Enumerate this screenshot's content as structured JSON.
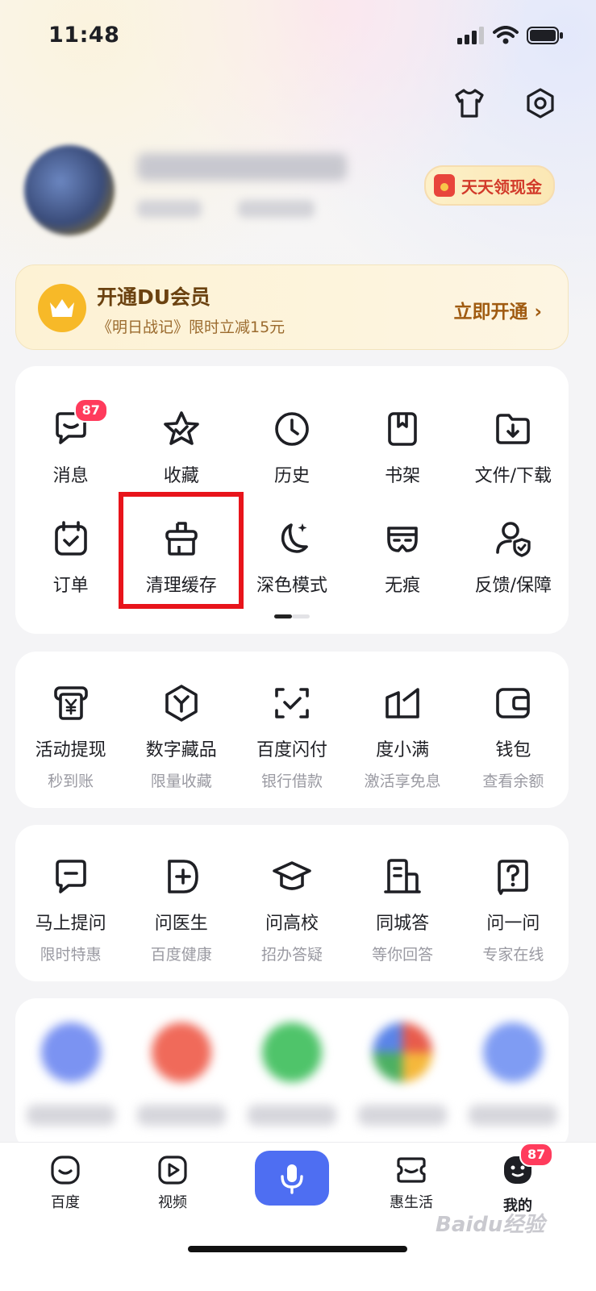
{
  "status_bar": {
    "time": "11:48"
  },
  "profile": {
    "cash_button": "天天领现金"
  },
  "vip": {
    "title": "开通DU会员",
    "subtitle": "《明日战记》限时立减15元",
    "cta": "立即开通 ›"
  },
  "tools": [
    {
      "label": "消息",
      "icon": "message-icon",
      "badge": "87"
    },
    {
      "label": "收藏",
      "icon": "star-icon"
    },
    {
      "label": "历史",
      "icon": "clock-icon"
    },
    {
      "label": "书架",
      "icon": "bookmark-icon"
    },
    {
      "label": "文件/下载",
      "icon": "download-folder-icon"
    },
    {
      "label": "订单",
      "icon": "calendar-check-icon"
    },
    {
      "label": "清理缓存",
      "icon": "broom-icon"
    },
    {
      "label": "深色模式",
      "icon": "moon-icon"
    },
    {
      "label": "无痕",
      "icon": "mask-icon"
    },
    {
      "label": "反馈/保障",
      "icon": "user-shield-icon"
    }
  ],
  "finance": [
    {
      "label": "活动提现",
      "sub": "秒到账",
      "icon": "cash-withdraw-icon"
    },
    {
      "label": "数字藏品",
      "sub": "限量收藏",
      "icon": "hexagon-y-icon"
    },
    {
      "label": "百度闪付",
      "sub": "银行借款",
      "icon": "scan-check-icon"
    },
    {
      "label": "度小满",
      "sub": "激活享免息",
      "icon": "duxiaoman-icon"
    },
    {
      "label": "钱包",
      "sub": "查看余额",
      "icon": "wallet-icon"
    }
  ],
  "qa": [
    {
      "label": "马上提问",
      "sub": "限时特惠",
      "icon": "question-bubble-icon"
    },
    {
      "label": "问医生",
      "sub": "百度健康",
      "icon": "medical-plus-icon"
    },
    {
      "label": "问高校",
      "sub": "招办答疑",
      "icon": "graduation-cap-icon"
    },
    {
      "label": "同城答",
      "sub": "等你回答",
      "icon": "building-icon"
    },
    {
      "label": "问一问",
      "sub": "专家在线",
      "icon": "question-mark-icon"
    }
  ],
  "tabbar": {
    "home": "百度",
    "video": "视频",
    "life": "惠生活",
    "mine": "我的",
    "mine_badge": "87"
  },
  "watermark": "Baidu经验",
  "colors": {
    "accent": "#4e6ef2",
    "badge": "#ff3b5c",
    "highlight": "#e8141b"
  }
}
